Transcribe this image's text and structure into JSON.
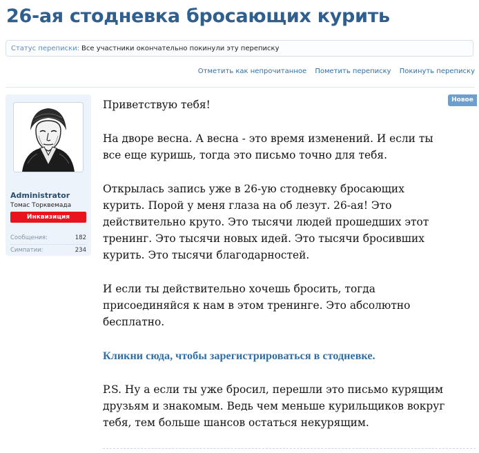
{
  "thread": {
    "title": "26-ая стодневка бросающих курить",
    "status_label": "Статус переписки:",
    "status_value": "Все участники окончательно покинули эту переписку"
  },
  "actions": {
    "mark_unread": "Отметить как непрочитанное",
    "flag": "Пометить переписку",
    "leave": "Покинуть переписку"
  },
  "user": {
    "name": "Administrator",
    "title": "Томас Торквемада",
    "badge": "Инквизиция",
    "badge_color": "#e8131d",
    "stats": {
      "messages_label": "Сообщения:",
      "messages_value": "182",
      "likes_label": "Симпатии:",
      "likes_value": "234"
    }
  },
  "message": {
    "new_badge": "Новое",
    "p1": "Приветствую тебя!",
    "p2": "На дворе весна. А весна - это время изменений. И если ты все еще куришь, тогда это письмо точно для тебя.",
    "p3": "Открылась запись уже в 26-ую стодневку бросающих курить. Порой у меня глаза на об лезут. 26-ая! Это действительно круто. Это тысячи людей прошедших этот тренинг. Это тысячи новых идей. Это тысячи бросивших курить. Это тысячи благодарностей.",
    "p4": "И если ты действительно хочешь бросить, тогда присоединяйся к нам в этом тренинге. Это абсолютно бесплатно.",
    "link": "Кликни сюда, чтобы зарегистрироваться в стодневке.",
    "p5": "P.S. Ну а если ты уже бросил, перешли это письмо курящим друзьям и знакомым. Ведь чем меньше курильщиков вокруг тебя, тем больше шансов остаться некурящим."
  },
  "colors": {
    "accent": "#2f5f8f",
    "link": "#2f6fa6",
    "panel": "#edf3fa"
  }
}
